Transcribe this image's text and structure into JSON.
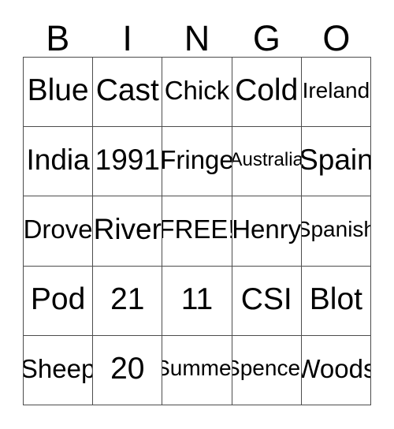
{
  "header": {
    "letters": [
      "B",
      "I",
      "N",
      "G",
      "O"
    ]
  },
  "grid": {
    "columns": 5,
    "rows": 5,
    "border_color": "#4d4d4d",
    "background_color": "#ffffff",
    "text_color": "#000000",
    "free_space_label": "FREE!",
    "cells": [
      [
        {
          "label": "Blue",
          "size": "fs-xl"
        },
        {
          "label": "Cast",
          "size": "fs-xl"
        },
        {
          "label": "Chick",
          "size": "fs-md"
        },
        {
          "label": "Cold",
          "size": "fs-xl"
        },
        {
          "label": "Ireland",
          "size": "fs-sm"
        }
      ],
      [
        {
          "label": "India",
          "size": "fs-lg"
        },
        {
          "label": "1991",
          "size": "fs-lg"
        },
        {
          "label": "Fringe",
          "size": "fs-md"
        },
        {
          "label": "Australia",
          "size": "fs-xs"
        },
        {
          "label": "Spain",
          "size": "fs-lg"
        }
      ],
      [
        {
          "label": "Drove",
          "size": "fs-md"
        },
        {
          "label": "River",
          "size": "fs-lg"
        },
        {
          "label": "FREE!",
          "size": "fs-md"
        },
        {
          "label": "Henry",
          "size": "fs-md"
        },
        {
          "label": "Spanish",
          "size": "fs-sm"
        }
      ],
      [
        {
          "label": "Pod",
          "size": "fs-xl"
        },
        {
          "label": "21",
          "size": "fs-xl"
        },
        {
          "label": "11",
          "size": "fs-xl"
        },
        {
          "label": "CSI",
          "size": "fs-xl"
        },
        {
          "label": "Blot",
          "size": "fs-xl"
        }
      ],
      [
        {
          "label": "Sheep",
          "size": "fs-md"
        },
        {
          "label": "20",
          "size": "fs-xl"
        },
        {
          "label": "Summer",
          "size": "fs-sm"
        },
        {
          "label": "Spencer",
          "size": "fs-sm"
        },
        {
          "label": "Woods",
          "size": "fs-md"
        }
      ]
    ]
  }
}
